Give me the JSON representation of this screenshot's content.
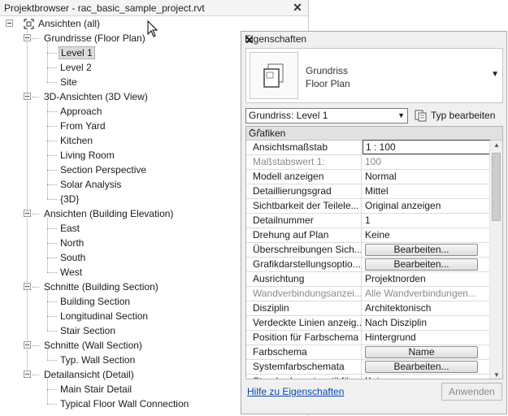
{
  "project_browser": {
    "title": "Projektbrowser - rac_basic_sample_project.rvt",
    "tree": [
      {
        "label": "Ansichten (all)",
        "level": 0,
        "toggle": true,
        "icon": "views-icon"
      },
      {
        "label": "Grundrisse (Floor Plan)",
        "level": 1,
        "toggle": true
      },
      {
        "label": "Level 1",
        "level": 2,
        "selected": true
      },
      {
        "label": "Level 2",
        "level": 2
      },
      {
        "label": "Site",
        "level": 2
      },
      {
        "label": "3D-Ansichten (3D View)",
        "level": 1,
        "toggle": true
      },
      {
        "label": "Approach",
        "level": 2
      },
      {
        "label": "From Yard",
        "level": 2
      },
      {
        "label": "Kitchen",
        "level": 2
      },
      {
        "label": "Living Room",
        "level": 2
      },
      {
        "label": "Section Perspective",
        "level": 2
      },
      {
        "label": "Solar Analysis",
        "level": 2
      },
      {
        "label": "{3D}",
        "level": 2
      },
      {
        "label": "Ansichten (Building Elevation)",
        "level": 1,
        "toggle": true
      },
      {
        "label": "East",
        "level": 2
      },
      {
        "label": "North",
        "level": 2
      },
      {
        "label": "South",
        "level": 2
      },
      {
        "label": "West",
        "level": 2
      },
      {
        "label": "Schnitte (Building Section)",
        "level": 1,
        "toggle": true
      },
      {
        "label": "Building Section",
        "level": 2
      },
      {
        "label": "Longitudinal Section",
        "level": 2
      },
      {
        "label": "Stair Section",
        "level": 2
      },
      {
        "label": "Schnitte (Wall Section)",
        "level": 1,
        "toggle": true
      },
      {
        "label": "Typ. Wall Section",
        "level": 2
      },
      {
        "label": "Detailansicht (Detail)",
        "level": 1,
        "toggle": true
      },
      {
        "label": "Main Stair Detail",
        "level": 2
      },
      {
        "label": "Typical Floor Wall Connection",
        "level": 2
      }
    ]
  },
  "properties": {
    "title": "Eigenschaften",
    "type_name_line1": "Grundriss",
    "type_name_line2": "Floor Plan",
    "instance_selector": "Grundriss: Level 1",
    "edit_type_label": "Typ bearbeiten",
    "group_label": "Grafiken",
    "rows": [
      {
        "name": "Ansichtsmaßstab",
        "value": "1 : 100",
        "kind": "edit"
      },
      {
        "name": "Maßstabswert 1:",
        "value": "100",
        "kind": "disabled"
      },
      {
        "name": "Modell anzeigen",
        "value": "Normal",
        "kind": "text"
      },
      {
        "name": "Detaillierungsgrad",
        "value": "Mittel",
        "kind": "text"
      },
      {
        "name": "Sichtbarkeit der Teilele...",
        "value": "Original anzeigen",
        "kind": "text"
      },
      {
        "name": "Detailnummer",
        "value": "1",
        "kind": "text"
      },
      {
        "name": "Drehung auf Plan",
        "value": "Keine",
        "kind": "text"
      },
      {
        "name": "Überschreibungen Sich...",
        "value": "Bearbeiten...",
        "kind": "button"
      },
      {
        "name": "Grafikdarstellungsoptio...",
        "value": "Bearbeiten...",
        "kind": "button"
      },
      {
        "name": "Ausrichtung",
        "value": "Projektnorden",
        "kind": "text"
      },
      {
        "name": "Wandverbindungsanzei...",
        "value": "Alle Wandverbindungen...",
        "kind": "disabled"
      },
      {
        "name": "Disziplin",
        "value": "Architektonisch",
        "kind": "text"
      },
      {
        "name": "Verdeckte Linien anzeig...",
        "value": "Nach Disziplin",
        "kind": "text"
      },
      {
        "name": "Position für Farbschema",
        "value": "Hintergrund",
        "kind": "text"
      },
      {
        "name": "Farbschema",
        "value": "Name",
        "kind": "button"
      },
      {
        "name": "Systemfarbschemata",
        "value": "Bearbeiten...",
        "kind": "button"
      },
      {
        "name": "Standardanzeigestil für ...",
        "value": "Keine",
        "kind": "text"
      }
    ],
    "help_link": "Hilfe zu Eigenschaften",
    "apply_label": "Anwenden"
  }
}
